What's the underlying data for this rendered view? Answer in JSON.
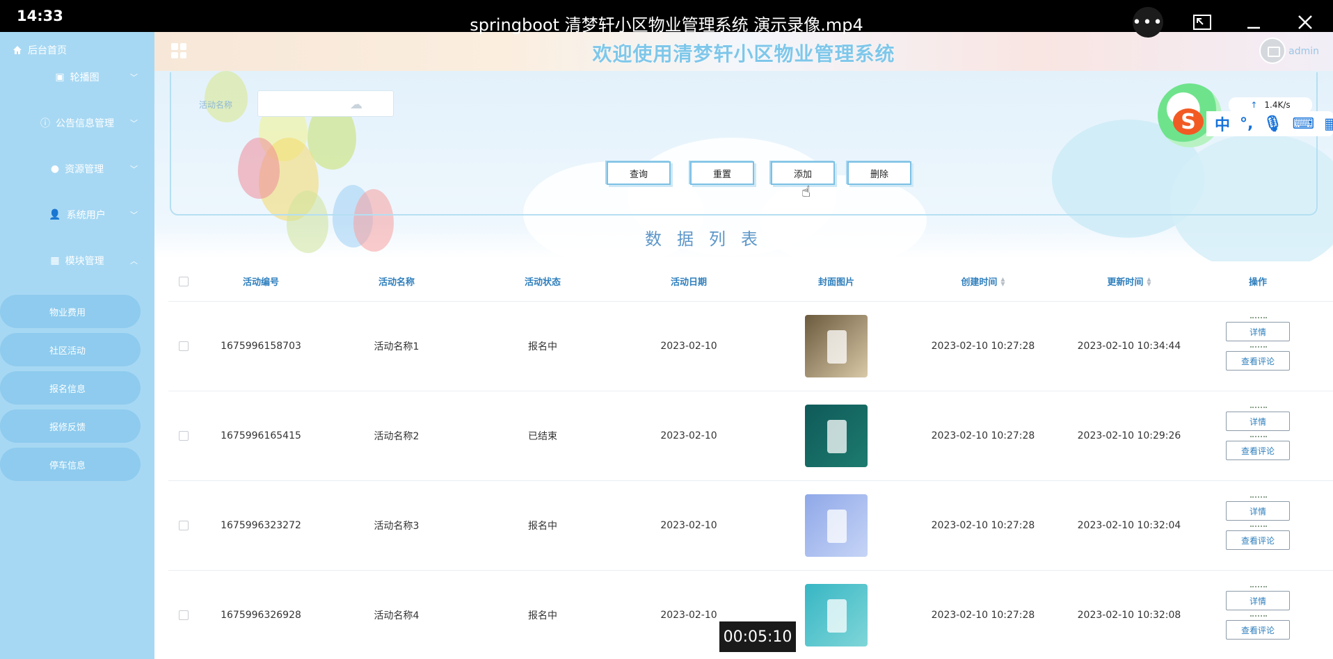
{
  "player": {
    "clock": "14:33",
    "title": "springboot 清梦轩小区物业管理系统 演示录像.mp4",
    "more_glyph": "•••",
    "timestamp": "00:05:10"
  },
  "sidebar": {
    "home_label": "后台首页",
    "items": [
      {
        "label": "轮播图",
        "icon": "image-icon"
      },
      {
        "label": "公告信息管理",
        "icon": "info-icon"
      },
      {
        "label": "资源管理",
        "icon": "location-icon"
      },
      {
        "label": "系统用户",
        "icon": "user-icon"
      },
      {
        "label": "模块管理",
        "icon": "grid-icon"
      }
    ],
    "subitems": [
      {
        "label": "物业费用"
      },
      {
        "label": "社区活动"
      },
      {
        "label": "报名信息"
      },
      {
        "label": "报修反馈"
      },
      {
        "label": "停车信息"
      }
    ]
  },
  "header": {
    "title": "欢迎使用清梦轩小区物业管理系统",
    "username": "admin"
  },
  "search": {
    "label": "活动名称",
    "value": "",
    "buttons": {
      "query": "查询",
      "reset": "重置",
      "add": "添加",
      "delete": "删除"
    }
  },
  "list_title": "数据列表",
  "table": {
    "columns": [
      "活动编号",
      "活动名称",
      "活动状态",
      "活动日期",
      "封面图片",
      "创建时间",
      "更新时间",
      "操作"
    ],
    "rows": [
      {
        "id": "1675996158703",
        "name": "活动名称1",
        "status": "报名中",
        "date": "2023-02-10",
        "cover_colors": [
          "#6b5a3d",
          "#d9c9a8"
        ],
        "created": "2023-02-10 10:27:28",
        "updated": "2023-02-10 10:34:44"
      },
      {
        "id": "1675996165415",
        "name": "活动名称2",
        "status": "已结束",
        "date": "2023-02-10",
        "cover_colors": [
          "#0f5a5a",
          "#1d7b6e"
        ],
        "created": "2023-02-10 10:27:28",
        "updated": "2023-02-10 10:29:26"
      },
      {
        "id": "1675996323272",
        "name": "活动名称3",
        "status": "报名中",
        "date": "2023-02-10",
        "cover_colors": [
          "#8fa8e8",
          "#c6d4f6"
        ],
        "created": "2023-02-10 10:27:28",
        "updated": "2023-02-10 10:32:04"
      },
      {
        "id": "1675996326928",
        "name": "活动名称4",
        "status": "报名中",
        "date": "2023-02-10",
        "cover_colors": [
          "#37b6c4",
          "#7fd6d8"
        ],
        "created": "2023-02-10 10:27:28",
        "updated": "2023-02-10 10:32:08"
      }
    ],
    "op_labels": {
      "detail": "详情",
      "comments": "查看评论"
    }
  },
  "ime": {
    "logo_letter": "S",
    "mode": "中",
    "punct": "°,",
    "speed": "1.4K/s",
    "speed_arrow": "↑"
  }
}
